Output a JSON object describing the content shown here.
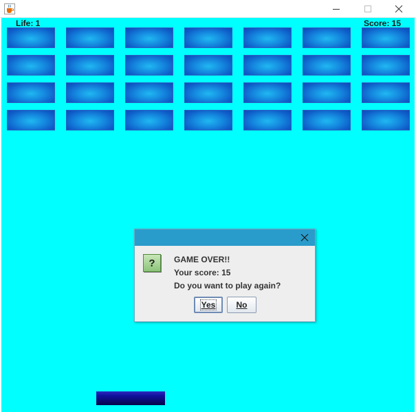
{
  "window": {
    "icon": "java-cup-icon",
    "controls": [
      "minimize-icon",
      "maximize-icon",
      "close-icon"
    ]
  },
  "hud": {
    "life_label": "Life: 1",
    "score_label": "Score:  15"
  },
  "bricks": {
    "rows": 4,
    "columns": 7,
    "color": "#1589df",
    "highlight": "#20b8f2"
  },
  "background_color": "#00ffff",
  "paddle": {
    "color": "#0a0a6e"
  },
  "dialog": {
    "icon": "question-icon",
    "icon_glyph": "?",
    "titlebar_color": "#2a9ccb",
    "line1": "GAME OVER!!",
    "line2": "Your score: 15",
    "line3": "Do you want to play again?",
    "yes_label": "Yes",
    "no_label": "No"
  }
}
